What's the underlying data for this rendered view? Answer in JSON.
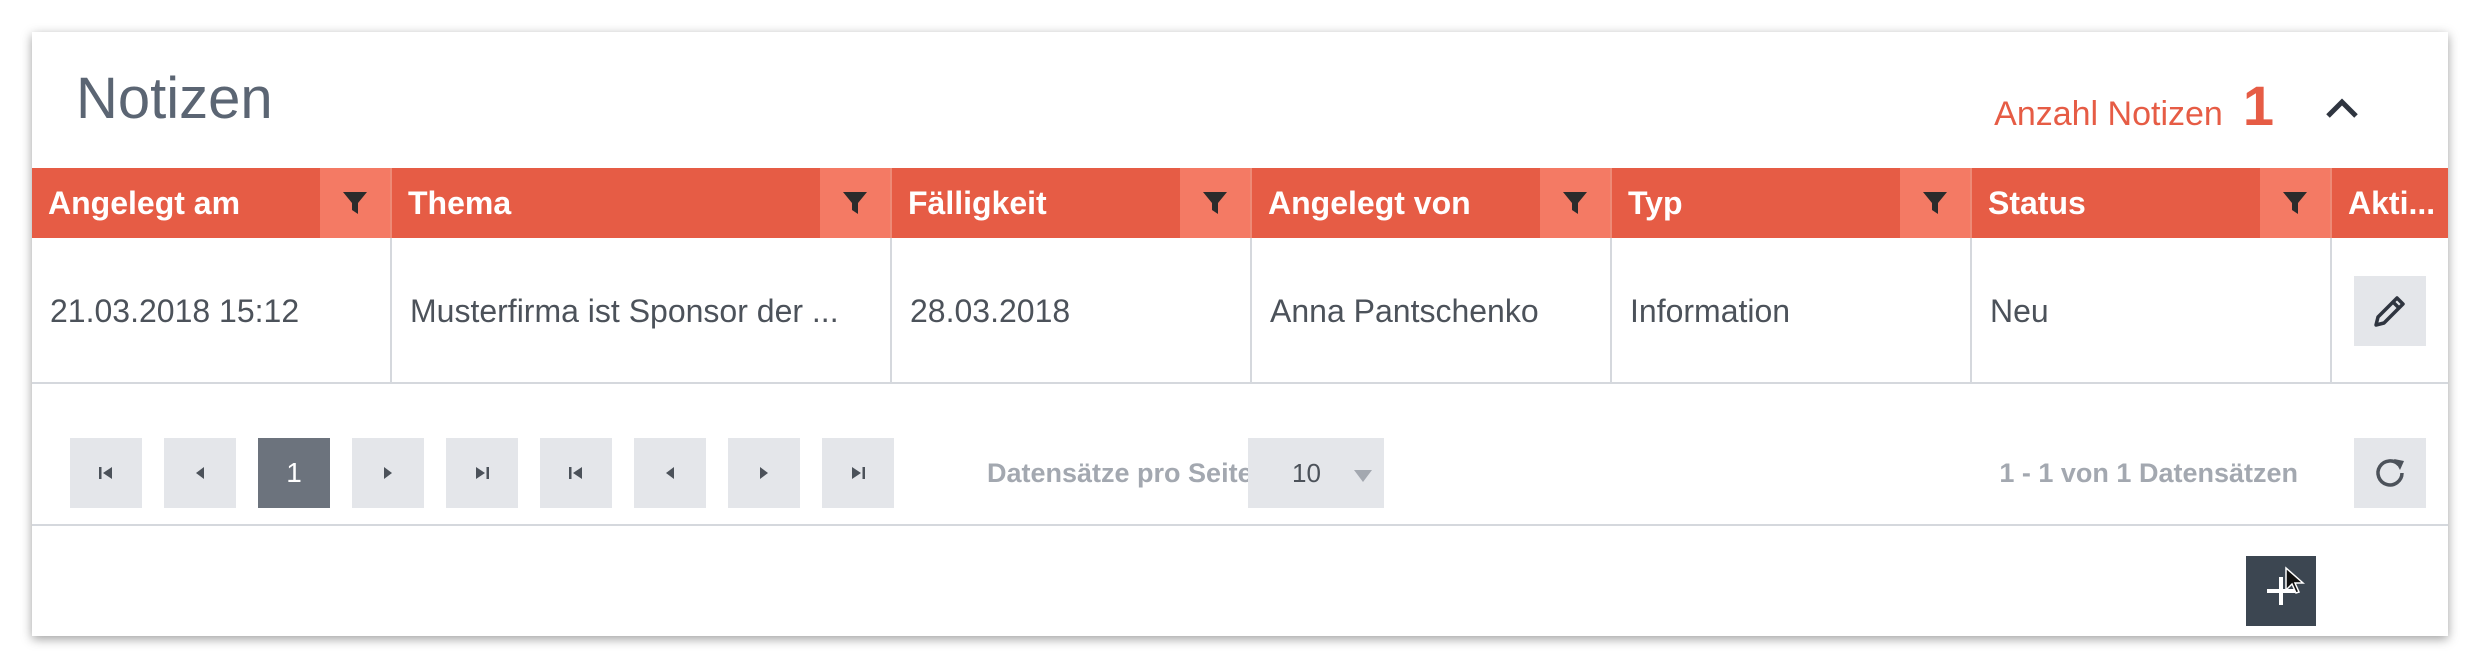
{
  "panel": {
    "title": "Notizen",
    "count_label": "Anzahl Notizen",
    "count_value": "1"
  },
  "table": {
    "columns": [
      "Angelegt am",
      "Thema",
      "Fälligkeit",
      "Angelegt von",
      "Typ",
      "Status",
      "Akti..."
    ],
    "rows": [
      [
        "21.03.2018 15:12",
        "Musterfirma ist Sponsor der ...",
        "28.03.2018",
        "Anna Pantschenko",
        "Information",
        "Neu"
      ]
    ]
  },
  "pager": {
    "current_page": "1",
    "page_size_label": "Datensätze pro Seite",
    "page_size": "10",
    "info": "1 - 1 von 1 Datensätzen"
  },
  "colors": {
    "accent": "#e65c45",
    "filter_bg": "#f47a64",
    "button_bg": "#e4e6ea",
    "dark_button": "#3c4651"
  },
  "icons": [
    "chevron-up-icon",
    "filter-icon",
    "pencil-icon",
    "first-page-icon",
    "prev-page-icon",
    "next-page-icon",
    "last-page-icon",
    "caret-down-icon",
    "refresh-icon",
    "plus-icon",
    "mouse-cursor-icon"
  ]
}
